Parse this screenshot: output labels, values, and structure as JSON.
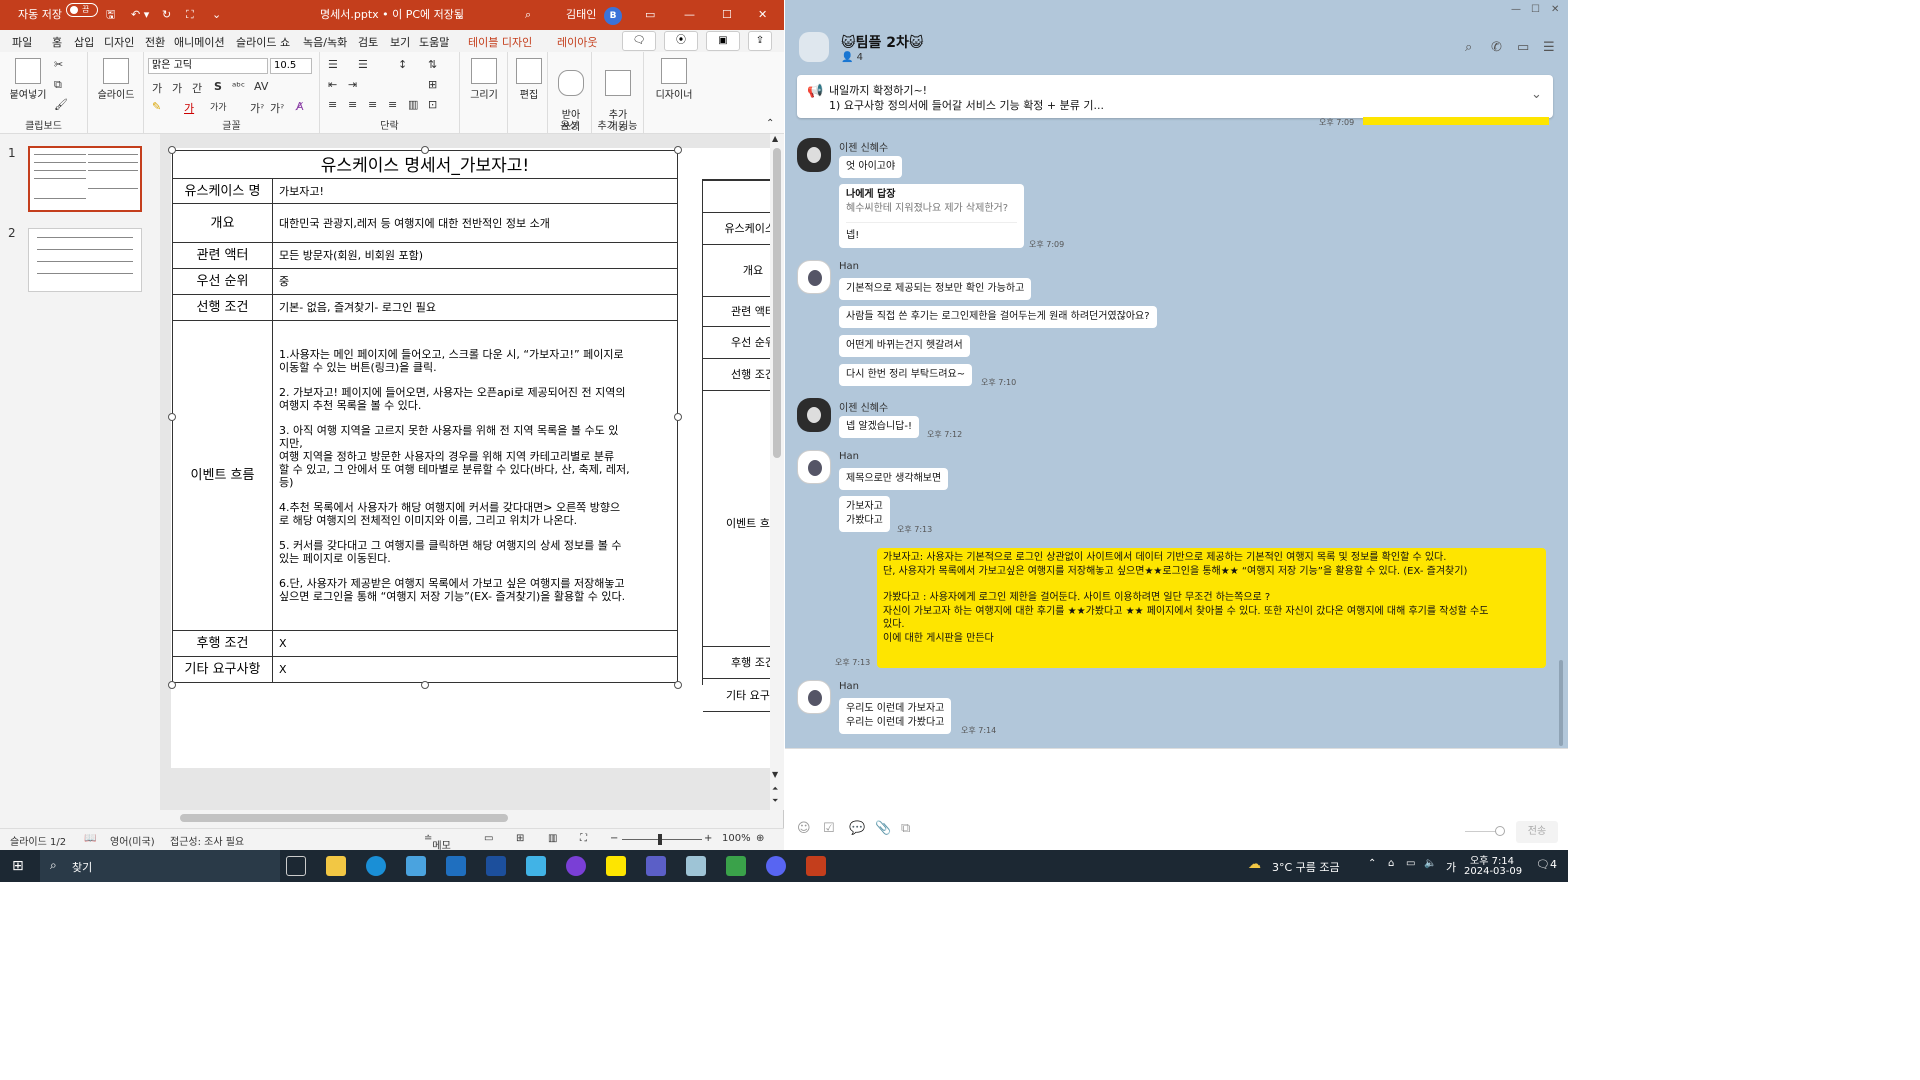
{
  "ppt": {
    "title_bar": {
      "autosave_label": "자동 저장",
      "autosave_state": "끔",
      "filename": "명세서.pptx • 이 PC에 저장됨",
      "user_name": "김태인",
      "user_initial": "B"
    },
    "menu": [
      "파일",
      "홈",
      "삽입",
      "디자인",
      "전환",
      "애니메이션",
      "슬라이드 쇼",
      "녹음/녹화",
      "검토",
      "보기",
      "도움말",
      "테이블 디자인",
      "레이아웃"
    ],
    "active_menu": "홈",
    "ribbon": {
      "paste": "붙여넣기",
      "clipboard": "클립보드",
      "slide": "슬라이드",
      "font_name": "맑은 고딕",
      "font_size": "10.5",
      "font_group": "글꼴",
      "paragraph_group": "단락",
      "draw": "그리기",
      "edit": "편집",
      "dictate": "받아\n쓰기",
      "voice_group": "음성",
      "addins": "추가\n기능",
      "addins_group": "추가 기능",
      "designer": "디자이너"
    },
    "slide_numbers": [
      "1",
      "2"
    ],
    "table": {
      "title": "유스케이스 명세서_가보자고!",
      "rows": [
        {
          "k": "유스케이스 명",
          "v": "가보자고!"
        },
        {
          "k": "개요",
          "v": "대한민국 관광지,레저 등 여행지에 대한 전반적인 정보 소개"
        },
        {
          "k": "관련 액터",
          "v": "모든 방문자(회원, 비회원 포함)"
        },
        {
          "k": "우선 순위",
          "v": "중"
        },
        {
          "k": "선행 조건",
          "v": "기본- 없음, 즐겨찾기- 로그인 필요"
        }
      ],
      "flow_label": "이벤트 흐름",
      "flow": [
        "1.사용자는 메인 페이지에 들어오고, 스크롤 다운 시, “가보자고!” 페이지로\n이동할 수 있는 버튼(링크)을 클릭.",
        "2. 가보자고! 페이지에 들어오면, 사용자는 오픈api로 제공되어진 전 지역의\n여행지 추천 목록을 볼 수 있다.",
        "3. 아직 여행 지역을 고르지 못한 사용자를 위해 전 지역 목록을 볼 수도 있\n지만,\n여행 지역을 정하고 방문한 사용자의 경우를 위해 지역 카테고리별로 분류\n할 수 있고, 그 안에서 또 여행 테마별로 분류할 수 있다(바다, 산, 축제, 레저,\n등)",
        "4.추천 목록에서 사용자가 해당 여행지에 커서를 갖다대면> 오른쪽 방향으\n로 해당 여행지의 전체적인 이미지와 이름, 그리고 위치가 나온다.",
        "5. 커서를 갖다대고 그 여행지를 클릭하면 해당 여행지의 상세 정보를 볼 수\n있는 페이지로 이동된다.",
        "6.단, 사용자가 제공받은 여행지 목록에서 가보고 싶은 여행지를 저장해놓고\n싶으면 로그인을 통해 “여행지 저장 기능”(EX- 즐겨찾기)을 활용할 수 있다."
      ],
      "post_rows": [
        {
          "k": "후행 조건",
          "v": "X"
        },
        {
          "k": "기타 요구사항",
          "v": "X"
        }
      ]
    },
    "ghost_table": [
      "유스케이스 '",
      "개요",
      "관련 액터",
      "우선 순위",
      "선행 조건",
      "이벤트 흐름",
      "후행 조건",
      "기타 요구사"
    ],
    "status": {
      "slide": "슬라이드 1/2",
      "lang": "영어(미국)",
      "access": "접근성: 조사 필요",
      "notes": "메모",
      "zoom": "100%"
    }
  },
  "chat": {
    "room": "😺팀플 2차😺",
    "members": "4",
    "notice_line1": "내일까지 확정하기~!",
    "notice_line2": "1) 요구사항 정의서에 들어갈 서비스 기능 확정 + 분류 기...",
    "top_time": "오후 7:09",
    "messages": {
      "s1": "이젠 신혜수",
      "m1": "엇 아이고야",
      "reply_head": "나에게 답장",
      "reply_quote": "혜수씨한테 지워졌나요 제가 삭제한거?",
      "reply_text": "넵!",
      "t1": "오후 7:09",
      "s2": "Han",
      "m2": "기본적으로 제공되는 정보만 확인 가능하고",
      "m3": "사람들 직접 쓴 후기는 로그인제한을 걸어두는게 원래 하려던거였잖아요?",
      "m4": "어떤게 바뀌는건지 헷갈려서",
      "m5": "다시 한번 정리 부탁드려요~",
      "t2": "오후 7:10",
      "s3": "이젠 신혜수",
      "m6": "넵 알겠습니답-!",
      "t3": "오후 7:12",
      "s4": "Han",
      "m7": "제목으로만 생각해보면",
      "m8a": "가보자고",
      "m8b": "가봤다고",
      "t4": "오후 7:13",
      "mine1": "가보자고: 사용자는 기본적으로 로그인 상관없이 사이트에서 데이터 기반으로 제공하는 기본적인 여행지 목록 및 정보를 확인할 수 있다.",
      "mine2": "단, 사용자가 목록에서 가보고싶은 여행지를 저장해놓고 싶으면★★로그인을 통해★★ “여행지 저장 기능”을 활용할 수 있다. (EX- 즐겨찾기)",
      "mine3": "가봤다고 : 사용자에게 로그인 제한을 걸어둔다. 사이트 이용하려면 일단 무조건 하는쪽으로 ?",
      "mine4": " 자신이 가보고자 하는 여행지에 대한 후기를 ★★가봤다고 ★★ 페이지에서 찾아볼 수 있다. 또한 자신이 갔다온 여행지에 대해 후기를 작성할 수도",
      "mine5": "있다.",
      "mine6": "이에 대한 게시판을 만든다",
      "t5": "오후 7:13",
      "s5": "Han",
      "m9a": "우리도 이런데 가보자고",
      "m9b": "우리는 이런데 가봤다고",
      "t6": "오후 7:14"
    },
    "send": "전송"
  },
  "taskbar": {
    "search": "찾기",
    "weather": "3°C  구름 조금",
    "ime": "가",
    "time": "오후 7:14",
    "date": "2024-03-09",
    "notif": "4"
  }
}
